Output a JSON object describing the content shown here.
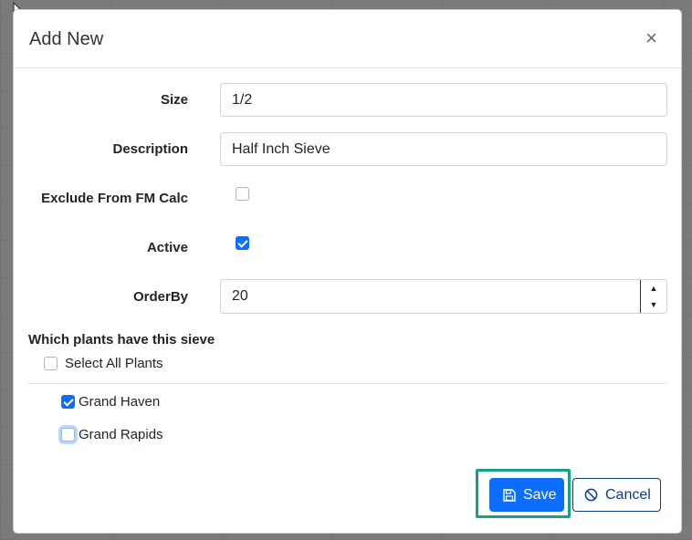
{
  "modal": {
    "title": "Add New",
    "close_glyph": "×"
  },
  "form": {
    "size": {
      "label": "Size",
      "value": "1/2"
    },
    "description": {
      "label": "Description",
      "value": "Half Inch Sieve"
    },
    "exclude_fm_calc": {
      "label": "Exclude From FM Calc",
      "checked": false
    },
    "active": {
      "label": "Active",
      "checked": true
    },
    "order_by": {
      "label": "OrderBy",
      "value": "20"
    }
  },
  "plants": {
    "section_title": "Which plants have this sieve",
    "select_all_label": "Select All Plants",
    "items": [
      {
        "label": "Grand Haven",
        "checked": true
      },
      {
        "label": "Grand Rapids",
        "checked": false
      }
    ]
  },
  "footer": {
    "save_label": "Save",
    "cancel_label": "Cancel",
    "save_icon": "floppy-disk-icon",
    "cancel_icon": "ban-icon"
  },
  "colors": {
    "primary": "#0d6efd",
    "highlight": "#16a085"
  }
}
